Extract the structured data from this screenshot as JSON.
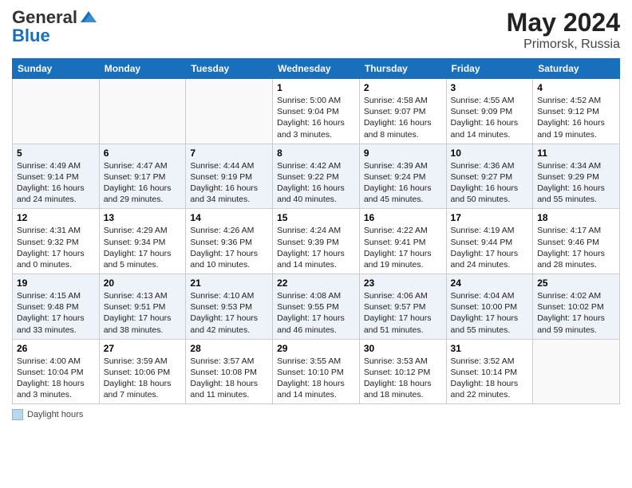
{
  "header": {
    "logo_general": "General",
    "logo_blue": "Blue",
    "month_year": "May 2024",
    "location": "Primorsk, Russia"
  },
  "footer": {
    "label": "Daylight hours"
  },
  "days_of_week": [
    "Sunday",
    "Monday",
    "Tuesday",
    "Wednesday",
    "Thursday",
    "Friday",
    "Saturday"
  ],
  "weeks": [
    [
      {
        "day": "",
        "info": ""
      },
      {
        "day": "",
        "info": ""
      },
      {
        "day": "",
        "info": ""
      },
      {
        "day": "1",
        "info": "Sunrise: 5:00 AM\nSunset: 9:04 PM\nDaylight: 16 hours\nand 3 minutes."
      },
      {
        "day": "2",
        "info": "Sunrise: 4:58 AM\nSunset: 9:07 PM\nDaylight: 16 hours\nand 8 minutes."
      },
      {
        "day": "3",
        "info": "Sunrise: 4:55 AM\nSunset: 9:09 PM\nDaylight: 16 hours\nand 14 minutes."
      },
      {
        "day": "4",
        "info": "Sunrise: 4:52 AM\nSunset: 9:12 PM\nDaylight: 16 hours\nand 19 minutes."
      }
    ],
    [
      {
        "day": "5",
        "info": "Sunrise: 4:49 AM\nSunset: 9:14 PM\nDaylight: 16 hours\nand 24 minutes."
      },
      {
        "day": "6",
        "info": "Sunrise: 4:47 AM\nSunset: 9:17 PM\nDaylight: 16 hours\nand 29 minutes."
      },
      {
        "day": "7",
        "info": "Sunrise: 4:44 AM\nSunset: 9:19 PM\nDaylight: 16 hours\nand 34 minutes."
      },
      {
        "day": "8",
        "info": "Sunrise: 4:42 AM\nSunset: 9:22 PM\nDaylight: 16 hours\nand 40 minutes."
      },
      {
        "day": "9",
        "info": "Sunrise: 4:39 AM\nSunset: 9:24 PM\nDaylight: 16 hours\nand 45 minutes."
      },
      {
        "day": "10",
        "info": "Sunrise: 4:36 AM\nSunset: 9:27 PM\nDaylight: 16 hours\nand 50 minutes."
      },
      {
        "day": "11",
        "info": "Sunrise: 4:34 AM\nSunset: 9:29 PM\nDaylight: 16 hours\nand 55 minutes."
      }
    ],
    [
      {
        "day": "12",
        "info": "Sunrise: 4:31 AM\nSunset: 9:32 PM\nDaylight: 17 hours\nand 0 minutes."
      },
      {
        "day": "13",
        "info": "Sunrise: 4:29 AM\nSunset: 9:34 PM\nDaylight: 17 hours\nand 5 minutes."
      },
      {
        "day": "14",
        "info": "Sunrise: 4:26 AM\nSunset: 9:36 PM\nDaylight: 17 hours\nand 10 minutes."
      },
      {
        "day": "15",
        "info": "Sunrise: 4:24 AM\nSunset: 9:39 PM\nDaylight: 17 hours\nand 14 minutes."
      },
      {
        "day": "16",
        "info": "Sunrise: 4:22 AM\nSunset: 9:41 PM\nDaylight: 17 hours\nand 19 minutes."
      },
      {
        "day": "17",
        "info": "Sunrise: 4:19 AM\nSunset: 9:44 PM\nDaylight: 17 hours\nand 24 minutes."
      },
      {
        "day": "18",
        "info": "Sunrise: 4:17 AM\nSunset: 9:46 PM\nDaylight: 17 hours\nand 28 minutes."
      }
    ],
    [
      {
        "day": "19",
        "info": "Sunrise: 4:15 AM\nSunset: 9:48 PM\nDaylight: 17 hours\nand 33 minutes."
      },
      {
        "day": "20",
        "info": "Sunrise: 4:13 AM\nSunset: 9:51 PM\nDaylight: 17 hours\nand 38 minutes."
      },
      {
        "day": "21",
        "info": "Sunrise: 4:10 AM\nSunset: 9:53 PM\nDaylight: 17 hours\nand 42 minutes."
      },
      {
        "day": "22",
        "info": "Sunrise: 4:08 AM\nSunset: 9:55 PM\nDaylight: 17 hours\nand 46 minutes."
      },
      {
        "day": "23",
        "info": "Sunrise: 4:06 AM\nSunset: 9:57 PM\nDaylight: 17 hours\nand 51 minutes."
      },
      {
        "day": "24",
        "info": "Sunrise: 4:04 AM\nSunset: 10:00 PM\nDaylight: 17 hours\nand 55 minutes."
      },
      {
        "day": "25",
        "info": "Sunrise: 4:02 AM\nSunset: 10:02 PM\nDaylight: 17 hours\nand 59 minutes."
      }
    ],
    [
      {
        "day": "26",
        "info": "Sunrise: 4:00 AM\nSunset: 10:04 PM\nDaylight: 18 hours\nand 3 minutes."
      },
      {
        "day": "27",
        "info": "Sunrise: 3:59 AM\nSunset: 10:06 PM\nDaylight: 18 hours\nand 7 minutes."
      },
      {
        "day": "28",
        "info": "Sunrise: 3:57 AM\nSunset: 10:08 PM\nDaylight: 18 hours\nand 11 minutes."
      },
      {
        "day": "29",
        "info": "Sunrise: 3:55 AM\nSunset: 10:10 PM\nDaylight: 18 hours\nand 14 minutes."
      },
      {
        "day": "30",
        "info": "Sunrise: 3:53 AM\nSunset: 10:12 PM\nDaylight: 18 hours\nand 18 minutes."
      },
      {
        "day": "31",
        "info": "Sunrise: 3:52 AM\nSunset: 10:14 PM\nDaylight: 18 hours\nand 22 minutes."
      },
      {
        "day": "",
        "info": ""
      }
    ]
  ]
}
